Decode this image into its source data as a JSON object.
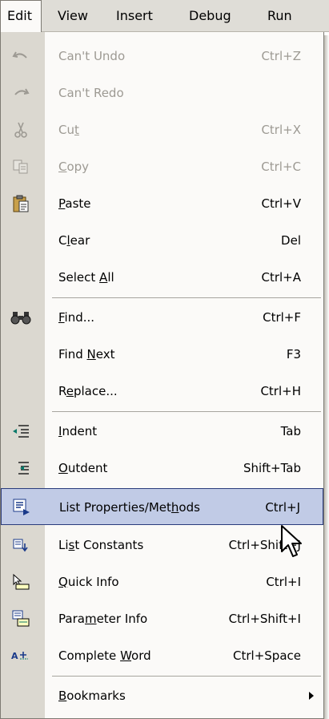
{
  "menubar": {
    "items": [
      {
        "label": "Edit",
        "active": true
      },
      {
        "label": "View"
      },
      {
        "label": "Insert"
      },
      {
        "label": "Debug"
      },
      {
        "label": "Run"
      }
    ]
  },
  "menu": {
    "items": [
      {
        "label": "Can't Undo",
        "shortcut": "Ctrl+Z",
        "icon": "undo-icon",
        "enabled": false
      },
      {
        "label": "Can't Redo",
        "shortcut": "",
        "icon": "redo-icon",
        "enabled": false
      },
      {
        "label": "Cut",
        "shortcut": "Ctrl+X",
        "icon": "scissors-icon",
        "enabled": false
      },
      {
        "label": "Copy",
        "shortcut": "Ctrl+C",
        "icon": "copy-icon",
        "enabled": false
      },
      {
        "label": "Paste",
        "shortcut": "Ctrl+V",
        "icon": "clipboard-icon",
        "enabled": true
      },
      {
        "label": "Clear",
        "shortcut": "Del",
        "icon": "",
        "enabled": true
      },
      {
        "label": "Select All",
        "shortcut": "Ctrl+A",
        "icon": "",
        "enabled": true
      },
      {
        "label": "Find...",
        "shortcut": "Ctrl+F",
        "icon": "binoculars-icon",
        "enabled": true
      },
      {
        "label": "Find Next",
        "shortcut": "F3",
        "icon": "",
        "enabled": true
      },
      {
        "label": "Replace...",
        "shortcut": "Ctrl+H",
        "icon": "",
        "enabled": true
      },
      {
        "label": "Indent",
        "shortcut": "Tab",
        "icon": "indent-icon",
        "enabled": true
      },
      {
        "label": "Outdent",
        "shortcut": "Shift+Tab",
        "icon": "outdent-icon",
        "enabled": true
      },
      {
        "label": "List Properties/Methods",
        "shortcut": "Ctrl+J",
        "icon": "list-properties-icon",
        "enabled": true,
        "highlighted": true
      },
      {
        "label": "List Constants",
        "shortcut": "Ctrl+Shift+J",
        "icon": "list-constants-icon",
        "enabled": true
      },
      {
        "label": "Quick Info",
        "shortcut": "Ctrl+I",
        "icon": "quick-info-icon",
        "enabled": true
      },
      {
        "label": "Parameter Info",
        "shortcut": "Ctrl+Shift+I",
        "icon": "parameter-info-icon",
        "enabled": true
      },
      {
        "label": "Complete Word",
        "shortcut": "Ctrl+Space",
        "icon": "complete-word-icon",
        "enabled": true
      },
      {
        "label": "Bookmarks",
        "shortcut": "",
        "icon": "",
        "enabled": true,
        "submenu": true
      }
    ]
  },
  "colors": {
    "menubar_bg": "#dfddd7",
    "menu_bg": "#fbfaf8",
    "iconbar_bg": "#dbd8d0",
    "highlight_bg": "#c1cbe6",
    "highlight_border": "#2a3c7c",
    "disabled_text": "#9d9a93"
  }
}
